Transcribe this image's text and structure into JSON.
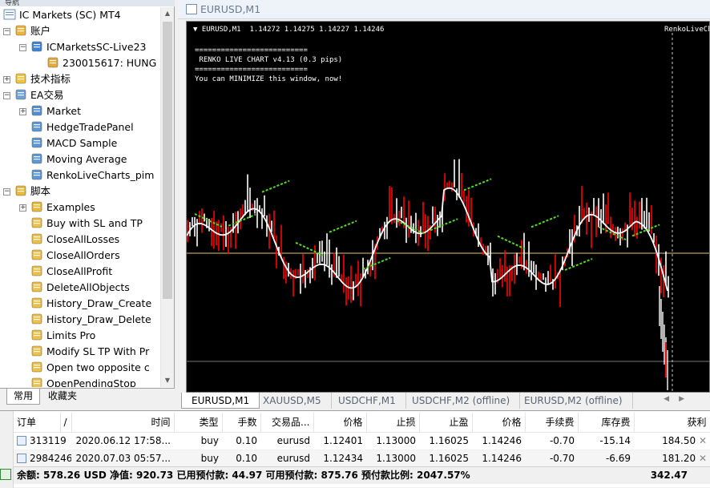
{
  "navigator": {
    "caption": "导航",
    "root": "IC Markets (SC) MT4",
    "tree": [
      {
        "label": "账户",
        "level": 1,
        "icon": "accounts-icon",
        "expander": "−"
      },
      {
        "label": "ICMarketsSC-Live23",
        "level": 2,
        "icon": "server-icon",
        "expander": "−"
      },
      {
        "label": "230015617: HUNG",
        "level": 3,
        "icon": "account-user-icon",
        "expander": ""
      },
      {
        "label": "技术指标",
        "level": 1,
        "icon": "indicators-icon",
        "expander": "+"
      },
      {
        "label": "EA交易",
        "level": 1,
        "icon": "expert-advisors-icon",
        "expander": "−"
      },
      {
        "label": "Market",
        "level": 2,
        "icon": "market-icon",
        "expander": "+"
      },
      {
        "label": "HedgeTradePanel",
        "level": 2,
        "icon": "expert-icon",
        "expander": ""
      },
      {
        "label": "MACD Sample",
        "level": 2,
        "icon": "expert-icon",
        "expander": ""
      },
      {
        "label": "Moving Average",
        "level": 2,
        "icon": "expert-icon",
        "expander": ""
      },
      {
        "label": "RenkoLiveCharts_pim",
        "level": 2,
        "icon": "expert-icon",
        "expander": ""
      },
      {
        "label": "脚本",
        "level": 1,
        "icon": "scripts-icon",
        "expander": "−"
      },
      {
        "label": "Examples",
        "level": 2,
        "icon": "script-folder-icon",
        "expander": "+"
      },
      {
        "label": "Buy with SL and TP",
        "level": 2,
        "icon": "script-icon",
        "expander": ""
      },
      {
        "label": "CloseAllLosses",
        "level": 2,
        "icon": "script-icon",
        "expander": ""
      },
      {
        "label": "CloseAllOrders",
        "level": 2,
        "icon": "script-icon",
        "expander": ""
      },
      {
        "label": "CloseAllProfit",
        "level": 2,
        "icon": "script-icon",
        "expander": ""
      },
      {
        "label": "DeleteAllObjects",
        "level": 2,
        "icon": "script-icon",
        "expander": ""
      },
      {
        "label": "History_Draw_Create",
        "level": 2,
        "icon": "script-icon",
        "expander": ""
      },
      {
        "label": "History_Draw_Delete",
        "level": 2,
        "icon": "script-icon",
        "expander": ""
      },
      {
        "label": "Limits Pro",
        "level": 2,
        "icon": "script-icon",
        "expander": ""
      },
      {
        "label": "Modify SL TP With Pr",
        "level": 2,
        "icon": "script-icon",
        "expander": ""
      },
      {
        "label": "Open two opposite c",
        "level": 2,
        "icon": "script-icon",
        "expander": ""
      },
      {
        "label": "OpenPendingStop",
        "level": 2,
        "icon": "script-icon",
        "expander": ""
      }
    ],
    "tabs": [
      "常用",
      "收藏夹"
    ]
  },
  "chart": {
    "window_title": "EURUSD,M1",
    "header": "▼ EURUSD,M1  1.14272 1.14275 1.14227 1.14246",
    "renko_text": "==========================\n RENKO LIVE CHART v4.13 (0.3 pips)\n==========================\nYou can MINIMIZE this window, now!",
    "corner_label": "RenkoLiveCha",
    "colors": {
      "background": "#000000",
      "up_bar": "#ffffff",
      "down_bar": "#ff0000",
      "ma_line": "#ffffff",
      "signal": "#55dd22",
      "price_line": "#e6c96e"
    }
  },
  "chart_tabs": [
    "EURUSD,M1",
    "XAUUSD,M5",
    "USDCHF,M1",
    "USDCHF,M2 (offline)",
    "EURUSD,M2 (offline)"
  ],
  "orders": {
    "headers": [
      "订单",
      "/",
      "时间",
      "类型",
      "手数",
      "交易品...",
      "价格",
      "止损",
      "止盈",
      "价格",
      "手续费",
      "库存费",
      "获利"
    ],
    "rows": [
      {
        "ticket": "313119",
        "time": "2020.06.12 17:58...",
        "type": "buy",
        "lots": "0.10",
        "symbol": "eurusd",
        "open_price": "1.12401",
        "sl": "1.13000",
        "tp": "1.16025",
        "price": "1.14246",
        "commission": "-0.70",
        "swap": "-15.14",
        "profit": "184.50"
      },
      {
        "ticket": "2984246",
        "time": "2020.07.03 05:57...",
        "type": "buy",
        "lots": "0.10",
        "symbol": "eurusd",
        "open_price": "1.12434",
        "sl": "1.13000",
        "tp": "1.16025",
        "price": "1.14246",
        "commission": "-0.70",
        "swap": "-6.69",
        "profit": "181.20"
      }
    ],
    "summary": "余额: 578.26 USD  净值: 920.73  已用预付款: 44.97  可用预付款: 875.76  预付款比例: 2047.57%",
    "total": "342.47"
  }
}
